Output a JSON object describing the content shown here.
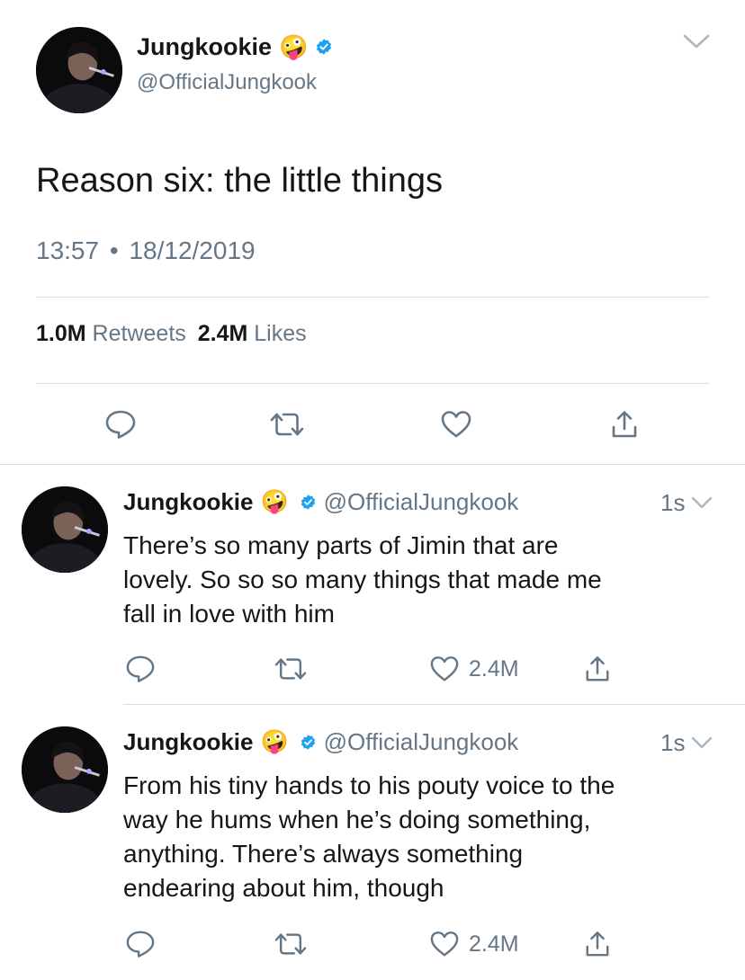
{
  "main_tweet": {
    "display_name": "Jungkookie",
    "emoji": "🤪",
    "handle": "@OfficialJungkook",
    "text": "Reason six: the little things",
    "time": "13:57",
    "separator": "•",
    "date": "18/12/2019",
    "retweets_count": "1.0M",
    "retweets_label": "Retweets",
    "likes_count": "2.4M",
    "likes_label": "Likes"
  },
  "replies": [
    {
      "display_name": "Jungkookie",
      "emoji": "🤪",
      "handle": "@OfficialJungkook",
      "age": "1s",
      "lines": [
        "There’s so many parts of Jimin that are",
        "lovely. So so so many things that made me",
        "fall in love with him"
      ],
      "like_count": "2.4M"
    },
    {
      "display_name": "Jungkookie",
      "emoji": "🤪",
      "handle": "@OfficialJungkook",
      "age": "1s",
      "lines": [
        "From his tiny hands to his pouty voice to the",
        "way he hums when he’s doing something,",
        "anything. There’s always something",
        "endearing about him, though"
      ],
      "like_count": "2.4M"
    }
  ],
  "colors": {
    "verified": "#1da1f2",
    "secondary_text": "#657786",
    "icon": "#657786",
    "divider": "#d8dde2"
  }
}
